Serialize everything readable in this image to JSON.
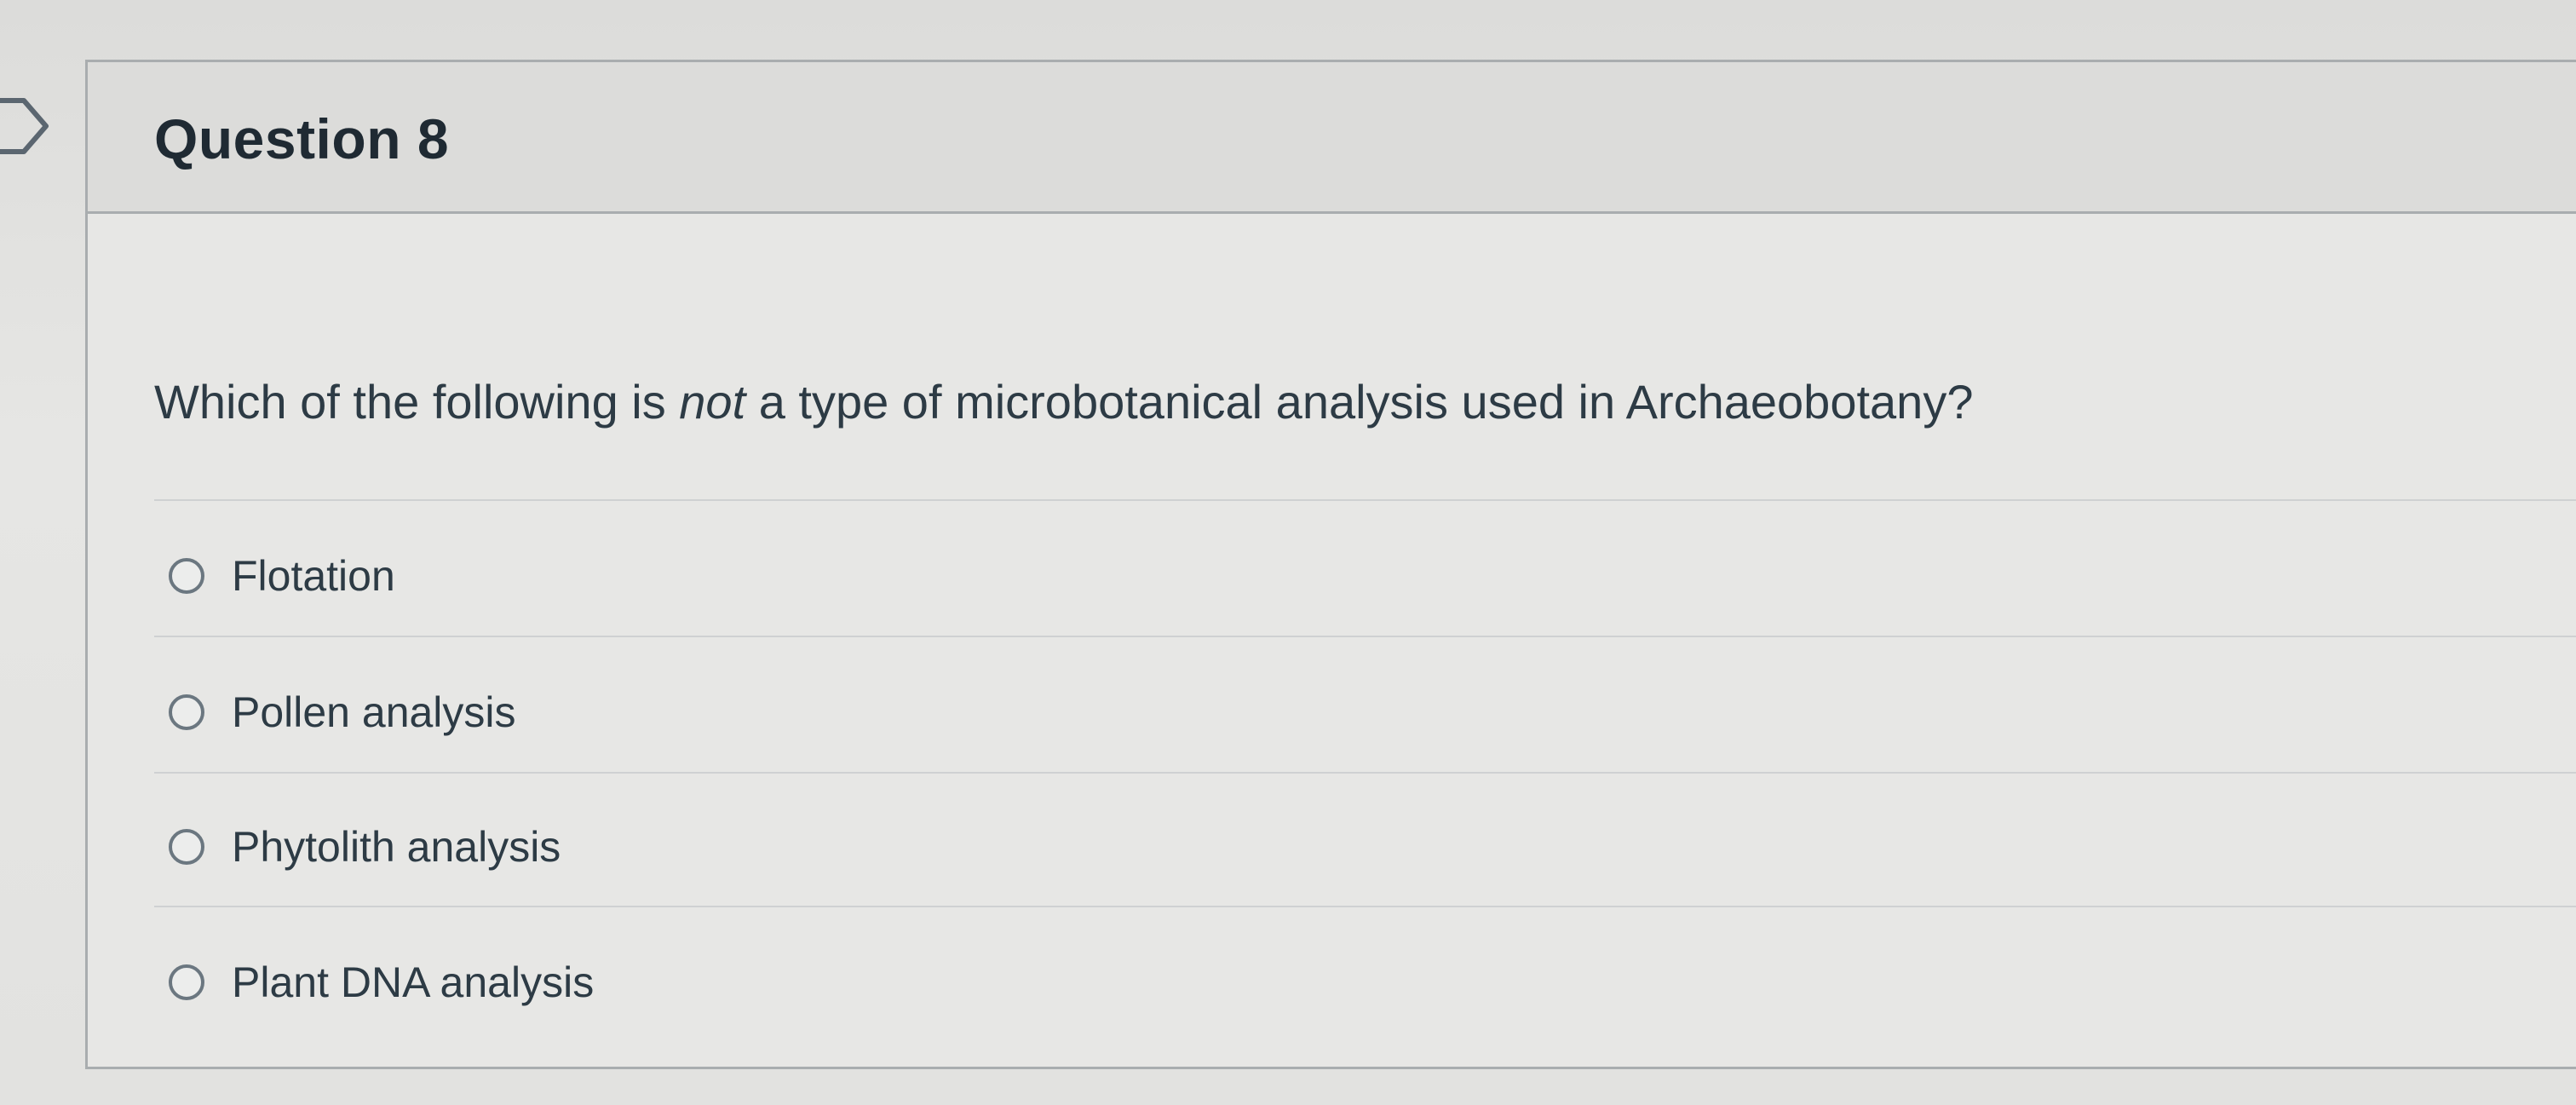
{
  "question": {
    "title": "Question 8",
    "text_before": "Which of the following is ",
    "text_emphasis": "not",
    "text_after": " a type of microbotanical analysis used in Archaeobotany?",
    "answers": [
      {
        "label": "Flotation",
        "selected": false
      },
      {
        "label": "Pollen analysis",
        "selected": false
      },
      {
        "label": "Phytolith analysis",
        "selected": false
      },
      {
        "label": "Plant DNA analysis",
        "selected": false
      }
    ]
  },
  "icons": {
    "flag": "flag-icon",
    "radio": "radio-button-icon"
  },
  "colors": {
    "text": "#2d3b45",
    "border": "#a9adaf",
    "radio_border": "#6b7780"
  }
}
